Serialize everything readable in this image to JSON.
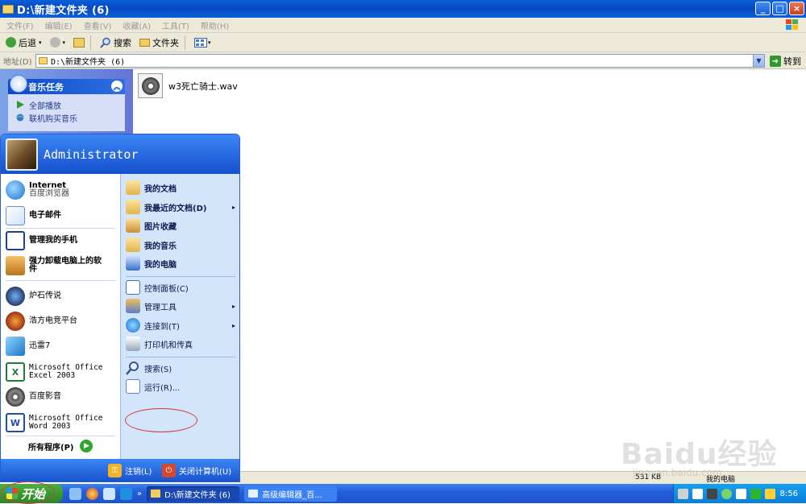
{
  "window": {
    "title": "D:\\新建文件夹 (6)",
    "buttons": {
      "minimize": "_",
      "maximize": "□",
      "close": "×"
    }
  },
  "menubar": [
    "文件(F)",
    "编辑(E)",
    "查看(V)",
    "收藏(A)",
    "工具(T)",
    "帮助(H)"
  ],
  "toolbar": {
    "back": "后退",
    "search": "搜索",
    "folders": "文件夹"
  },
  "addressbar": {
    "label": "地址(D)",
    "value": "D:\\新建文件夹 (6)",
    "go": "转到"
  },
  "tasks": {
    "title": "音乐任务",
    "items": [
      "全部播放",
      "联机购买音乐"
    ]
  },
  "files": [
    {
      "name": "w3死亡骑士.wav",
      "icon": "media-file-icon"
    }
  ],
  "startmenu": {
    "user": "Administrator",
    "left_items": [
      {
        "line1": "Internet",
        "line2": "百度浏览器"
      },
      {
        "line1": "电子邮件"
      },
      {
        "line1": "管理我的手机"
      },
      {
        "line1": "强力卸载电脑上的软",
        "line2": "件"
      },
      {
        "line1": "炉石传说"
      },
      {
        "line1": "浩方电竞平台"
      },
      {
        "line1": "迅雷7"
      },
      {
        "line1": "Microsoft Office",
        "line2": "Excel 2003"
      },
      {
        "line1": "百度影音"
      },
      {
        "line1": "Microsoft Office",
        "line2": "Word 2003"
      }
    ],
    "all_programs": "所有程序(P)",
    "right_items": [
      {
        "label": "我的文档"
      },
      {
        "label": "我最近的文档(D)",
        "arrow": "▸"
      },
      {
        "label": "图片收藏"
      },
      {
        "label": "我的音乐"
      },
      {
        "label": "我的电脑"
      },
      {
        "label": "控制面板(C)"
      },
      {
        "label": "管理工具",
        "arrow": "▸"
      },
      {
        "label": "连接到(T)",
        "arrow": "▸"
      },
      {
        "label": "打印机和传真"
      },
      {
        "label": "搜索(S)"
      },
      {
        "label": "运行(R)..."
      }
    ],
    "logoff": "注销(L)",
    "shutdown": "关闭计算机(U)"
  },
  "statusbar": {
    "size": "531 KB",
    "location": "我的电脑"
  },
  "taskbar": {
    "start": "开始",
    "chevron": "»",
    "buttons": [
      "D:\\新建文件夹 (6)",
      "高级编辑器_百..."
    ],
    "time": "8:56"
  },
  "watermark": {
    "brand": "Baidu经验",
    "site": "jingyan.baidu.com"
  },
  "colors": {
    "xp_blue": "#0a5fd8",
    "start_green": "#3a9a2f",
    "menu_panel": "#d3e5fa"
  }
}
